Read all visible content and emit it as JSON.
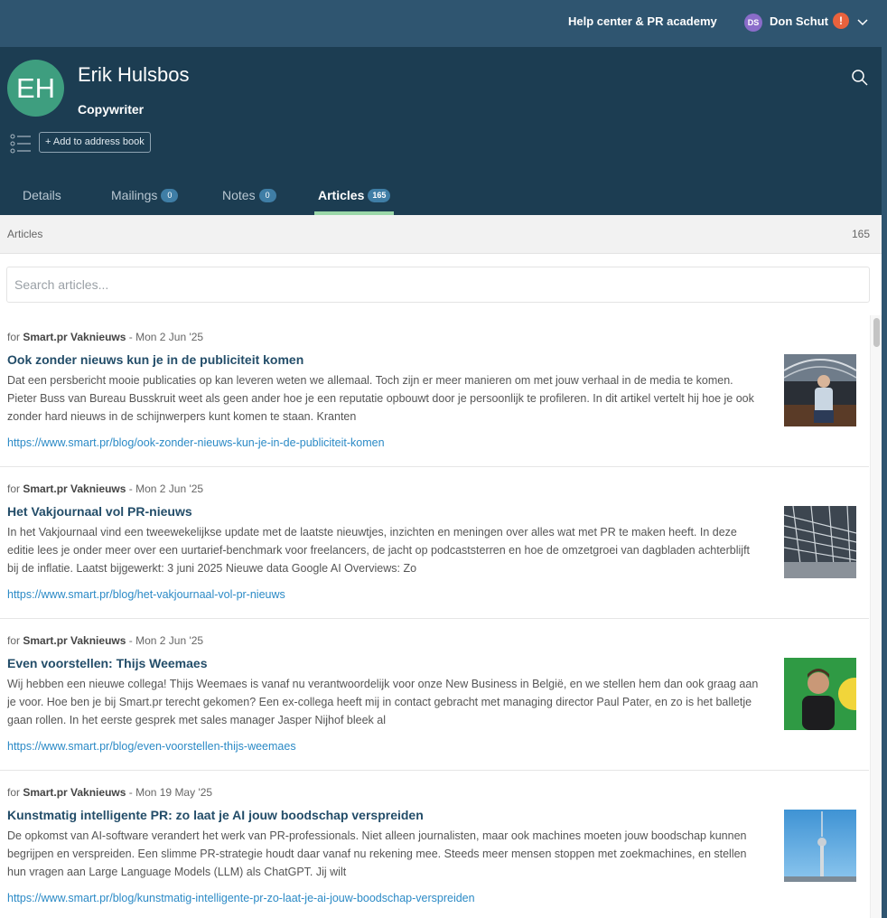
{
  "topbar": {
    "help_link": "Help center & PR academy",
    "user_initials": "DS",
    "user_name": "Don Schut",
    "alert_label": "!",
    "icons": [
      "chevron-down-icon"
    ],
    "colors": {
      "bar": "#2f5570",
      "avatar": "#8a6cc9",
      "alert": "#e9623d"
    }
  },
  "profile": {
    "initials": "EH",
    "name": "Erik Hulsbos",
    "role": "Copywriter",
    "add_button": "+ Add to address book",
    "icons": [
      "search-icon",
      "list-icon"
    ],
    "colors": {
      "header": "#1c3d52",
      "avatar": "#3e9e7f",
      "active_tab": "#9ad7a8"
    }
  },
  "tabs": [
    {
      "label": "Details",
      "count": ""
    },
    {
      "label": "Mailings",
      "count": "0"
    },
    {
      "label": "Notes",
      "count": "0"
    },
    {
      "label": "Articles",
      "count": "165",
      "active": true
    }
  ],
  "section": {
    "title": "Articles",
    "count": "165"
  },
  "search": {
    "placeholder": "Search articles..."
  },
  "articles": [
    {
      "for_label": "for",
      "outlet": "Smart.pr Vaknieuws",
      "date": "- Mon 2 Jun '25",
      "title": "Ook zonder nieuws kun je in de publiciteit komen",
      "body": "Dat een persbericht mooie publicaties op kan leveren weten we allemaal. Toch zijn er meer manieren om met jouw verhaal in de media te komen. Pieter Buss van Bureau Busskruit weet als geen ander hoe je een reputatie opbouwt door je persoonlijk te profileren. In dit artikel vertelt hij hoe je ook zonder hard nieuws in de schijnwerpers kunt komen te staan. Kranten",
      "url": "https://www.smart.pr/blog/ook-zonder-nieuws-kun-je-in-de-publiciteit-komen"
    },
    {
      "for_label": "for",
      "outlet": "Smart.pr Vaknieuws",
      "date": "- Mon 2 Jun '25",
      "title": "Het Vakjournaal vol PR-nieuws",
      "body": "In het Vakjournaal vind een tweewekelijkse update met de laatste nieuwtjes, inzichten en meningen over alles wat met PR te maken heeft. In deze editie lees je onder meer over een uurtarief-benchmark voor freelancers, de jacht op podcaststerren en hoe de omzetgroei van dagbladen achterblijft bij de inflatie. Laatst bijgewerkt: 3 juni 2025 Nieuwe data Google AI Overviews: Zo",
      "url": "https://www.smart.pr/blog/het-vakjournaal-vol-pr-nieuws"
    },
    {
      "for_label": "for",
      "outlet": "Smart.pr Vaknieuws",
      "date": "- Mon 2 Jun '25",
      "title": "Even voorstellen: Thijs Weemaes",
      "body": "Wij hebben een nieuwe collega! Thijs Weemaes is vanaf nu verantwoordelijk voor onze New Business in België, en we stellen hem dan ook graag aan je voor. Hoe ben je bij Smart.pr terecht gekomen? Een ex-collega heeft mij in contact gebracht met managing director Paul Pater, en zo is het balletje gaan rollen. In het eerste gesprek met sales manager Jasper Nijhof bleek al",
      "url": "https://www.smart.pr/blog/even-voorstellen-thijs-weemaes"
    },
    {
      "for_label": "for",
      "outlet": "Smart.pr Vaknieuws",
      "date": "- Mon 19 May '25",
      "title": "Kunstmatig intelligente PR: zo laat je AI jouw boodschap verspreiden",
      "body": "De opkomst van AI-software verandert het werk van PR-professionals. Niet alleen journalisten, maar ook machines moeten jouw boodschap kunnen begrijpen en verspreiden. Een slimme PR-strategie houdt daar vanaf nu rekening mee. Steeds meer mensen stoppen met zoekmachines, en stellen hun vragen aan Large Language Models (LLM) als ChatGPT. Jij wilt",
      "url": "https://www.smart.pr/blog/kunstmatig-intelligente-pr-zo-laat-je-ai-jouw-boodschap-verspreiden"
    }
  ]
}
